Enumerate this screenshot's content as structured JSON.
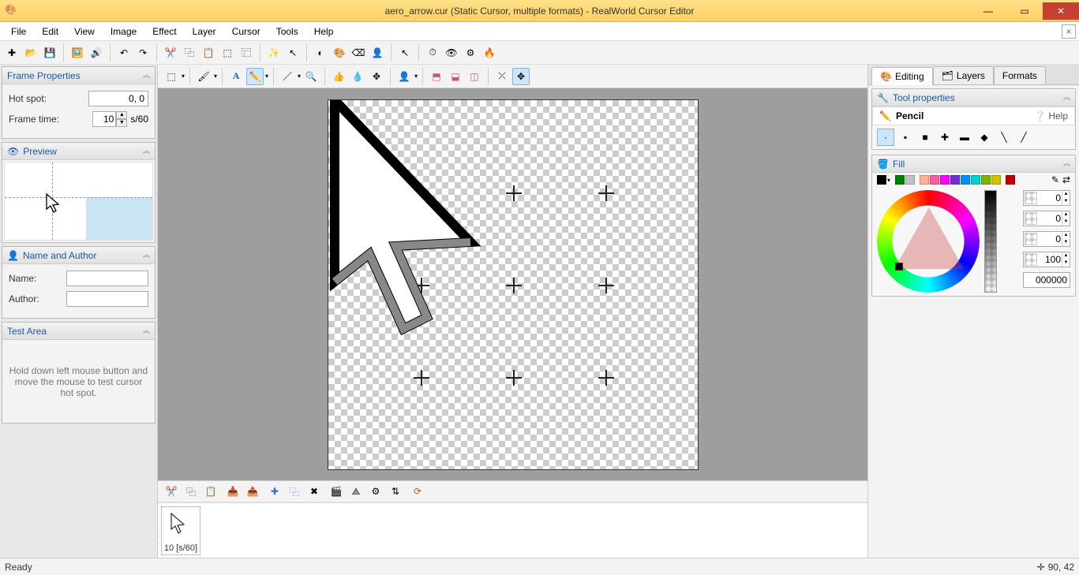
{
  "title": "aero_arrow.cur (Static Cursor, multiple formats) - RealWorld Cursor Editor",
  "menu": [
    "File",
    "Edit",
    "View",
    "Image",
    "Effect",
    "Layer",
    "Cursor",
    "Tools",
    "Help"
  ],
  "panels": {
    "frameProps": {
      "title": "Frame Properties",
      "hotspot_label": "Hot spot:",
      "hotspot_value": "0, 0",
      "frametime_label": "Frame time:",
      "frametime_value": "10",
      "frametime_unit": "s/60"
    },
    "preview": {
      "title": "Preview"
    },
    "nameAuthor": {
      "title": "Name and Author",
      "name_label": "Name:",
      "name_value": "",
      "author_label": "Author:",
      "author_value": ""
    },
    "testArea": {
      "title": "Test Area",
      "hint": "Hold down left mouse button and move the mouse to test cursor hot spot."
    }
  },
  "right": {
    "tabs": [
      "Editing",
      "Layers",
      "Formats"
    ],
    "toolProps": {
      "title": "Tool properties",
      "tool_name": "Pencil",
      "help": "Help"
    },
    "fill": {
      "title": "Fill",
      "rgb": [
        "0",
        "0",
        "0"
      ],
      "alpha": "100",
      "hex": "000000"
    }
  },
  "frames": {
    "frame_label": "10 [s/60]"
  },
  "status": {
    "ready": "Ready",
    "coords": "90, 42"
  },
  "swatches": [
    "#000000",
    "#ffffff",
    "#008000",
    "#808080",
    "#ff8c69",
    "#ff69b4",
    "#ff00ff",
    "#8a2be2",
    "#0080ff",
    "#00d0ff",
    "#00b050",
    "#b0b000",
    "#d00000"
  ]
}
